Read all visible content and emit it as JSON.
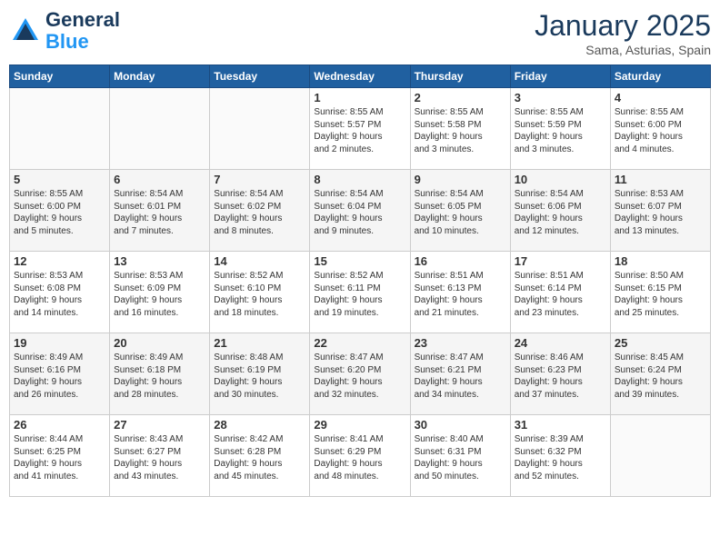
{
  "logo": {
    "line1": "General",
    "line2": "Blue"
  },
  "title": "January 2025",
  "location": "Sama, Asturias, Spain",
  "weekdays": [
    "Sunday",
    "Monday",
    "Tuesday",
    "Wednesday",
    "Thursday",
    "Friday",
    "Saturday"
  ],
  "weeks": [
    [
      {
        "day": "",
        "info": ""
      },
      {
        "day": "",
        "info": ""
      },
      {
        "day": "",
        "info": ""
      },
      {
        "day": "1",
        "info": "Sunrise: 8:55 AM\nSunset: 5:57 PM\nDaylight: 9 hours\nand 2 minutes."
      },
      {
        "day": "2",
        "info": "Sunrise: 8:55 AM\nSunset: 5:58 PM\nDaylight: 9 hours\nand 3 minutes."
      },
      {
        "day": "3",
        "info": "Sunrise: 8:55 AM\nSunset: 5:59 PM\nDaylight: 9 hours\nand 3 minutes."
      },
      {
        "day": "4",
        "info": "Sunrise: 8:55 AM\nSunset: 6:00 PM\nDaylight: 9 hours\nand 4 minutes."
      }
    ],
    [
      {
        "day": "5",
        "info": "Sunrise: 8:55 AM\nSunset: 6:00 PM\nDaylight: 9 hours\nand 5 minutes."
      },
      {
        "day": "6",
        "info": "Sunrise: 8:54 AM\nSunset: 6:01 PM\nDaylight: 9 hours\nand 7 minutes."
      },
      {
        "day": "7",
        "info": "Sunrise: 8:54 AM\nSunset: 6:02 PM\nDaylight: 9 hours\nand 8 minutes."
      },
      {
        "day": "8",
        "info": "Sunrise: 8:54 AM\nSunset: 6:04 PM\nDaylight: 9 hours\nand 9 minutes."
      },
      {
        "day": "9",
        "info": "Sunrise: 8:54 AM\nSunset: 6:05 PM\nDaylight: 9 hours\nand 10 minutes."
      },
      {
        "day": "10",
        "info": "Sunrise: 8:54 AM\nSunset: 6:06 PM\nDaylight: 9 hours\nand 12 minutes."
      },
      {
        "day": "11",
        "info": "Sunrise: 8:53 AM\nSunset: 6:07 PM\nDaylight: 9 hours\nand 13 minutes."
      }
    ],
    [
      {
        "day": "12",
        "info": "Sunrise: 8:53 AM\nSunset: 6:08 PM\nDaylight: 9 hours\nand 14 minutes."
      },
      {
        "day": "13",
        "info": "Sunrise: 8:53 AM\nSunset: 6:09 PM\nDaylight: 9 hours\nand 16 minutes."
      },
      {
        "day": "14",
        "info": "Sunrise: 8:52 AM\nSunset: 6:10 PM\nDaylight: 9 hours\nand 18 minutes."
      },
      {
        "day": "15",
        "info": "Sunrise: 8:52 AM\nSunset: 6:11 PM\nDaylight: 9 hours\nand 19 minutes."
      },
      {
        "day": "16",
        "info": "Sunrise: 8:51 AM\nSunset: 6:13 PM\nDaylight: 9 hours\nand 21 minutes."
      },
      {
        "day": "17",
        "info": "Sunrise: 8:51 AM\nSunset: 6:14 PM\nDaylight: 9 hours\nand 23 minutes."
      },
      {
        "day": "18",
        "info": "Sunrise: 8:50 AM\nSunset: 6:15 PM\nDaylight: 9 hours\nand 25 minutes."
      }
    ],
    [
      {
        "day": "19",
        "info": "Sunrise: 8:49 AM\nSunset: 6:16 PM\nDaylight: 9 hours\nand 26 minutes."
      },
      {
        "day": "20",
        "info": "Sunrise: 8:49 AM\nSunset: 6:18 PM\nDaylight: 9 hours\nand 28 minutes."
      },
      {
        "day": "21",
        "info": "Sunrise: 8:48 AM\nSunset: 6:19 PM\nDaylight: 9 hours\nand 30 minutes."
      },
      {
        "day": "22",
        "info": "Sunrise: 8:47 AM\nSunset: 6:20 PM\nDaylight: 9 hours\nand 32 minutes."
      },
      {
        "day": "23",
        "info": "Sunrise: 8:47 AM\nSunset: 6:21 PM\nDaylight: 9 hours\nand 34 minutes."
      },
      {
        "day": "24",
        "info": "Sunrise: 8:46 AM\nSunset: 6:23 PM\nDaylight: 9 hours\nand 37 minutes."
      },
      {
        "day": "25",
        "info": "Sunrise: 8:45 AM\nSunset: 6:24 PM\nDaylight: 9 hours\nand 39 minutes."
      }
    ],
    [
      {
        "day": "26",
        "info": "Sunrise: 8:44 AM\nSunset: 6:25 PM\nDaylight: 9 hours\nand 41 minutes."
      },
      {
        "day": "27",
        "info": "Sunrise: 8:43 AM\nSunset: 6:27 PM\nDaylight: 9 hours\nand 43 minutes."
      },
      {
        "day": "28",
        "info": "Sunrise: 8:42 AM\nSunset: 6:28 PM\nDaylight: 9 hours\nand 45 minutes."
      },
      {
        "day": "29",
        "info": "Sunrise: 8:41 AM\nSunset: 6:29 PM\nDaylight: 9 hours\nand 48 minutes."
      },
      {
        "day": "30",
        "info": "Sunrise: 8:40 AM\nSunset: 6:31 PM\nDaylight: 9 hours\nand 50 minutes."
      },
      {
        "day": "31",
        "info": "Sunrise: 8:39 AM\nSunset: 6:32 PM\nDaylight: 9 hours\nand 52 minutes."
      },
      {
        "day": "",
        "info": ""
      }
    ]
  ]
}
